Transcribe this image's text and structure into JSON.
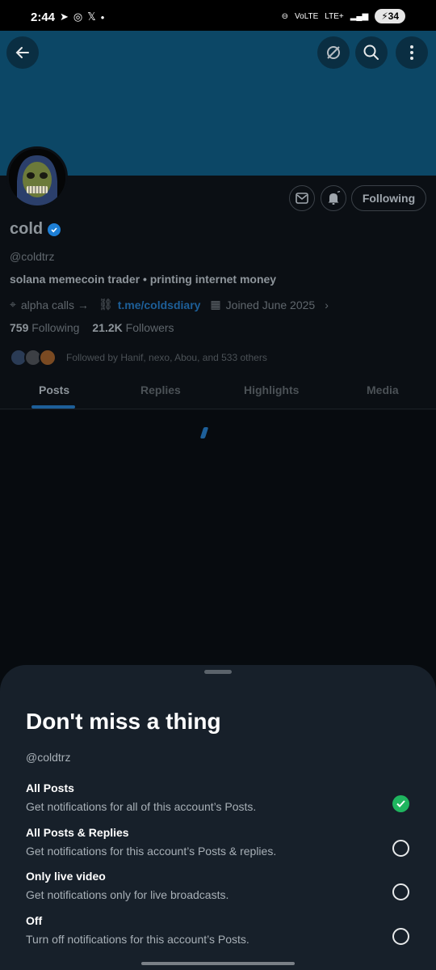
{
  "status_bar": {
    "time": "2:44",
    "battery": "34",
    "network": "LTE+"
  },
  "profile": {
    "name": "cold",
    "handle": "@coldtrz",
    "bio": "solana memecoin trader • printing internet money",
    "location": "alpha calls →",
    "link": "t.me/coldsdiary",
    "joined": "Joined June 2025",
    "following_count": "759",
    "following_label": "Following",
    "followers_count": "21.2K",
    "followers_label": "Followers",
    "followed_by": "Followed by Hanif, nexo, Abou, and 533 others",
    "follow_button": "Following"
  },
  "tabs": [
    {
      "label": "Posts",
      "active": true
    },
    {
      "label": "Replies",
      "active": false
    },
    {
      "label": "Highlights",
      "active": false
    },
    {
      "label": "Media",
      "active": false
    }
  ],
  "sheet": {
    "title": "Don't miss a thing",
    "handle": "@coldtrz",
    "options": [
      {
        "title": "All Posts",
        "description": "Get notifications for all of this account’s Posts.",
        "selected": true
      },
      {
        "title": "All Posts & Replies",
        "description": "Get notifications for this account’s Posts & replies.",
        "selected": false
      },
      {
        "title": "Only live video",
        "description": "Get notifications only for live broadcasts.",
        "selected": false
      },
      {
        "title": "Off",
        "description": "Turn off notifications for this account’s Posts.",
        "selected": false
      }
    ]
  },
  "colors": {
    "banner": "#0c4766",
    "accent": "#1d5f99",
    "check": "#1fb55f",
    "sheet": "#17202a"
  }
}
